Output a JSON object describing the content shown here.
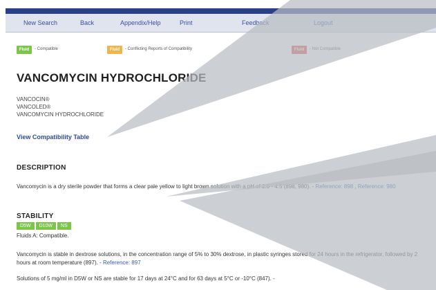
{
  "nav": {
    "items": [
      "New Search",
      "Back",
      "Appendix/Help",
      "Print",
      "Feedback",
      "Logout"
    ]
  },
  "legend": {
    "compatible": {
      "badge": "Fluid",
      "label": "- Compatible",
      "color": "#7cc44a"
    },
    "conflicting": {
      "badge": "Fluid",
      "label": "- Conflicting Reports of Compatibility",
      "color": "#f0b54a"
    },
    "not_compatible": {
      "badge": "Fluid",
      "label": "- Not Compatible",
      "color": "#d9534f"
    }
  },
  "drug": {
    "title": "VANCOMYCIN HYDROCHLORIDE",
    "names": [
      "VANCOCIN®",
      "VANCOLED®",
      "VANCOMYCIN HYDROCHLORIDE"
    ],
    "view_table_link": "View Compatibility Table"
  },
  "description": {
    "heading": "DESCRIPTION",
    "text": "Vancomycin is a dry sterile powder that forms a clear pale yellow to light brown solution with a pH of 2.5 - 4.5 (898, 980). - ",
    "ref1": "Reference: 898",
    "sep": " , ",
    "ref2": "Reference: 980"
  },
  "stability": {
    "heading": "STABILITY",
    "badges": [
      "D5W",
      "D10W",
      "NS"
    ],
    "fluids_text": "Fluids A: Compatible.",
    "para1_text": "Vancomycin is stable in dextrose solutions, in the concentration range of 5% to 30% dextrose, in plastic syringes stored for 24 hours in the refrigerator, followed by 2 hours at room temperature (897). - ",
    "para1_ref": "Reference: 897",
    "para2_text": "Solutions of 5 mg/ml in D5W or NS are stable for 17 days at 24°C and for 63 days at 5°C or -10°C (847). -"
  },
  "colors": {
    "brand": "#2a3f8a",
    "nav_bg": "#dfe4ef",
    "overlay": "#b9bcc2"
  }
}
